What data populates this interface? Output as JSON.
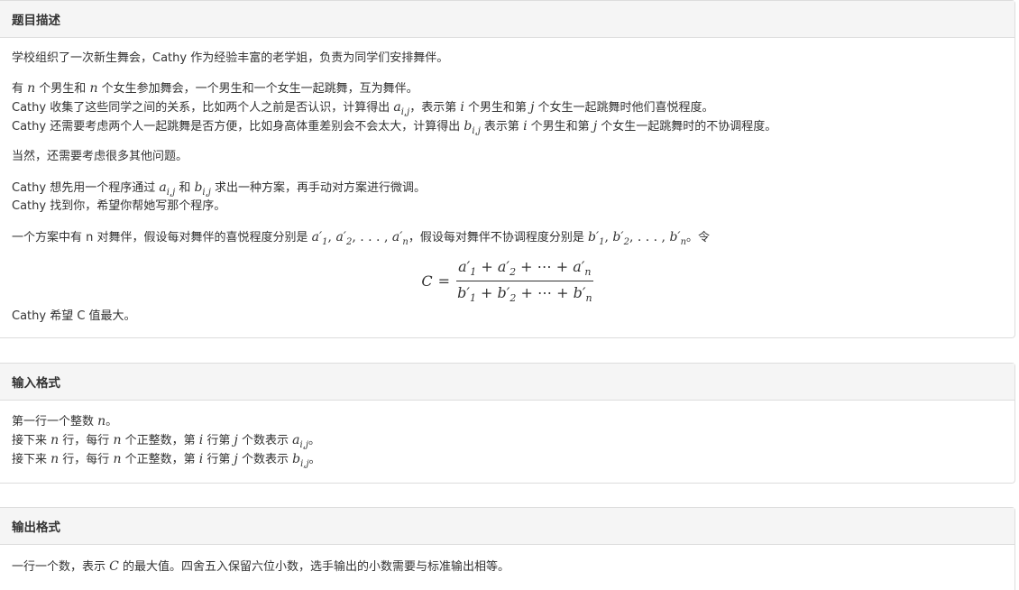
{
  "sections": {
    "description": {
      "title": "题目描述",
      "p1": "学校组织了一次新生舞会，Cathy 作为经验丰富的老学姐，负责为同学们安排舞伴。",
      "p2a_1": "有 ",
      "p2a_2": " 个男生和 ",
      "p2a_3": " 个女生参加舞会，一个男生和一个女生一起跳舞，互为舞伴。",
      "p2b_1": "Cathy 收集了这些同学之间的关系，比如两个人之前是否认识，计算得出 ",
      "p2b_2": "，表示第 ",
      "p2b_3": " 个男生和第 ",
      "p2b_4": " 个女生一起跳舞时他们喜悦程度。",
      "p2c_1": "Cathy 还需要考虑两个人一起跳舞是否方便，比如身高体重差别会不会太大，计算得出 ",
      "p2c_2": " 表示第 ",
      "p2c_3": " 个男生和第 ",
      "p2c_4": " 个女生一起跳舞时的不协调程度。",
      "p3": "当然，还需要考虑很多其他问题。",
      "p4a_1": "Cathy 想先用一个程序通过 ",
      "p4a_2": " 和 ",
      "p4a_3": " 求出一种方案，再手动对方案进行微调。",
      "p4b": "Cathy 找到你，希望你帮她写那个程序。",
      "p5_1": "一个方案中有 n 对舞伴，假设每对舞伴的喜悦程度分别是 ",
      "p5_2": "，假设每对舞伴不协调程度分别是 ",
      "p5_3": "。令",
      "p6": "Cathy 希望 C 值最大。"
    },
    "input": {
      "title": "输入格式",
      "l1_1": "第一行一个整数 ",
      "l1_2": "。",
      "l2_1": "接下来 ",
      "l2_2": " 行，每行 ",
      "l2_3": " 个正整数，第 ",
      "l2_4": " 行第 ",
      "l2_5": " 个数表示 ",
      "l2_6": "。",
      "l3_1": "接下来 ",
      "l3_2": " 行，每行 ",
      "l3_3": " 个正整数，第 ",
      "l3_4": " 行第 ",
      "l3_5": " 个数表示 ",
      "l3_6": "。"
    },
    "output": {
      "title": "输出格式",
      "l1_1": "一行一个数，表示 ",
      "l1_2": " 的最大值。四舍五入保留六位小数，选手输出的小数需要与标准输出相等。"
    }
  },
  "math": {
    "n": "n",
    "i": "i",
    "j": "j",
    "C": "C",
    "a": "a",
    "b": "b",
    "ij": "i,j"
  }
}
